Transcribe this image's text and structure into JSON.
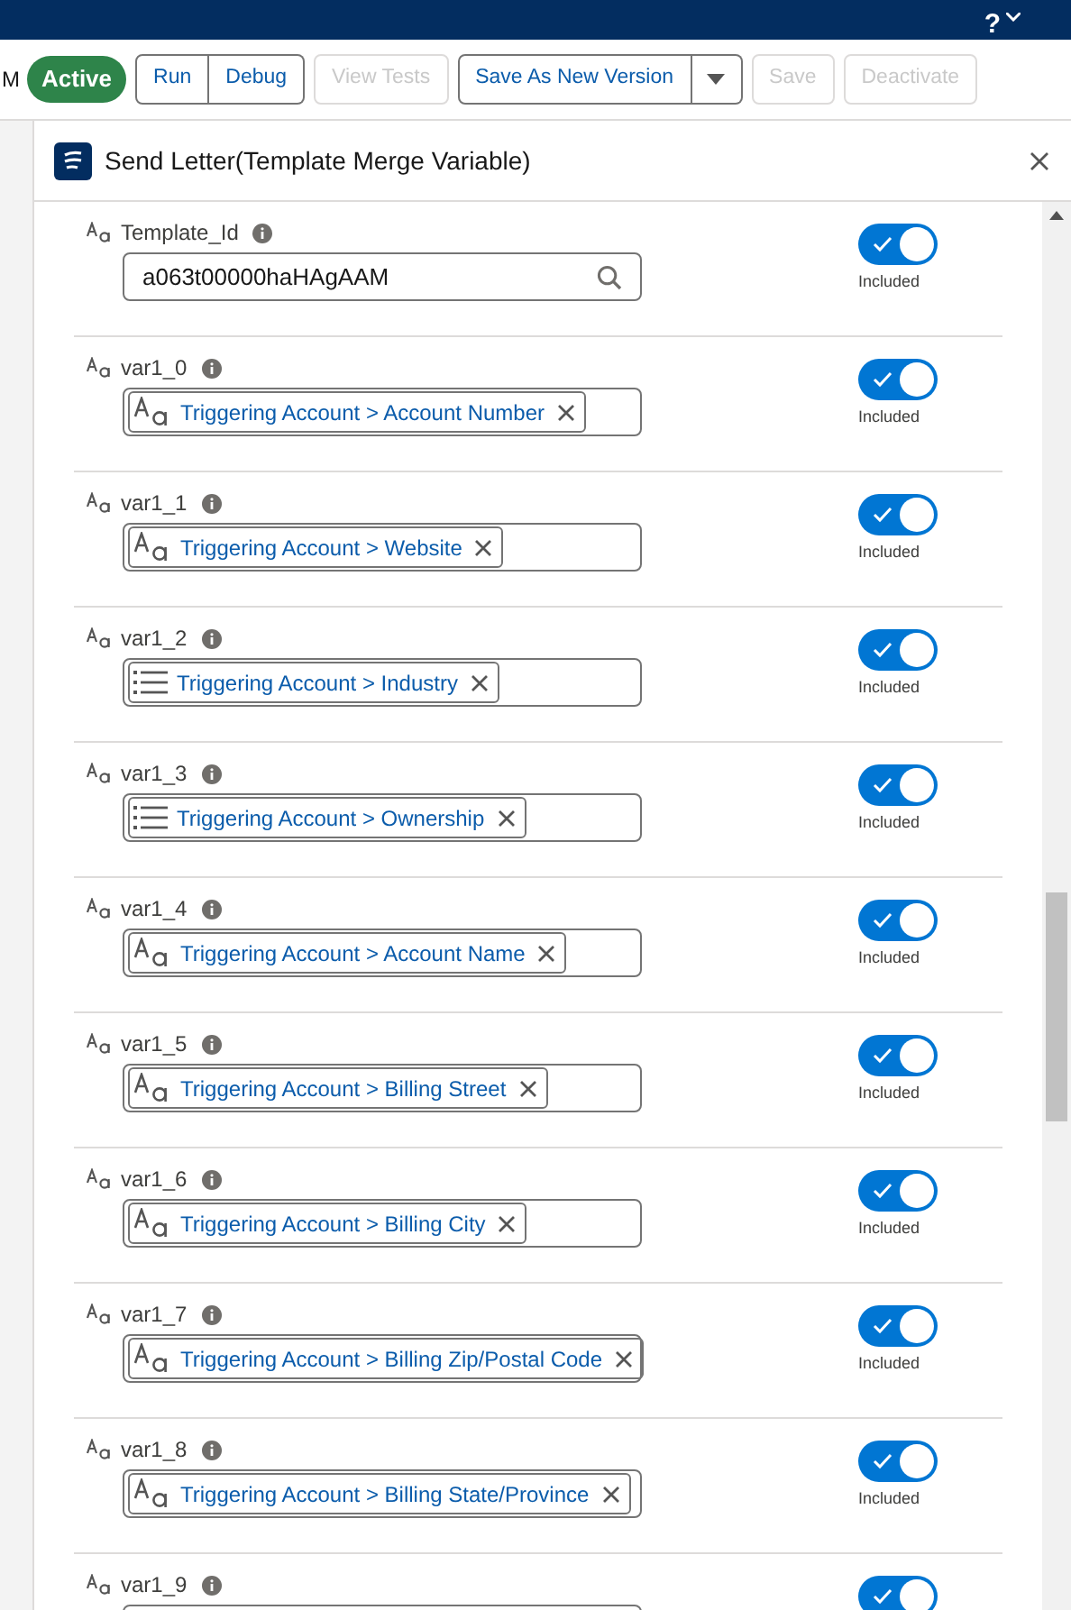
{
  "top_bar": {
    "help": "?"
  },
  "toolbar": {
    "cut_label": "M",
    "status": "Active",
    "button_groups": [
      [
        {
          "label": "Run",
          "disabled": false
        },
        {
          "label": "Debug",
          "disabled": false
        }
      ],
      [
        {
          "label": "View Tests",
          "disabled": true
        }
      ],
      [
        {
          "label": "Save As New Version",
          "disabled": false,
          "menu": true
        }
      ],
      [
        {
          "label": "Save",
          "disabled": true
        }
      ],
      [
        {
          "label": "Deactivate",
          "disabled": true
        }
      ]
    ]
  },
  "panel": {
    "title": "Send Letter(Template Merge Variable)",
    "variables": [
      {
        "name": "Template_Id",
        "kind": "lookup",
        "value": "a063t00000haHAgAAM",
        "included": true,
        "toggle_label": "Included"
      },
      {
        "name": "var1_0",
        "kind": "text",
        "value": "Triggering Account > Account Number",
        "included": true,
        "toggle_label": "Included"
      },
      {
        "name": "var1_1",
        "kind": "text",
        "value": "Triggering Account > Website",
        "included": true,
        "toggle_label": "Included"
      },
      {
        "name": "var1_2",
        "kind": "picklist",
        "value": "Triggering Account > Industry",
        "included": true,
        "toggle_label": "Included"
      },
      {
        "name": "var1_3",
        "kind": "picklist",
        "value": "Triggering Account > Ownership",
        "included": true,
        "toggle_label": "Included"
      },
      {
        "name": "var1_4",
        "kind": "text",
        "value": "Triggering Account > Account Name",
        "included": true,
        "toggle_label": "Included"
      },
      {
        "name": "var1_5",
        "kind": "text",
        "value": "Triggering Account > Billing Street",
        "included": true,
        "toggle_label": "Included"
      },
      {
        "name": "var1_6",
        "kind": "text",
        "value": "Triggering Account > Billing City",
        "included": true,
        "toggle_label": "Included"
      },
      {
        "name": "var1_7",
        "kind": "text",
        "value": "Triggering Account > Billing Zip/Postal Code",
        "included": true,
        "toggle_label": "Included"
      },
      {
        "name": "var1_8",
        "kind": "text",
        "value": "Triggering Account > Billing State/Province",
        "included": true,
        "toggle_label": "Included"
      },
      {
        "name": "var1_9",
        "kind": "cut",
        "included": true
      }
    ]
  }
}
